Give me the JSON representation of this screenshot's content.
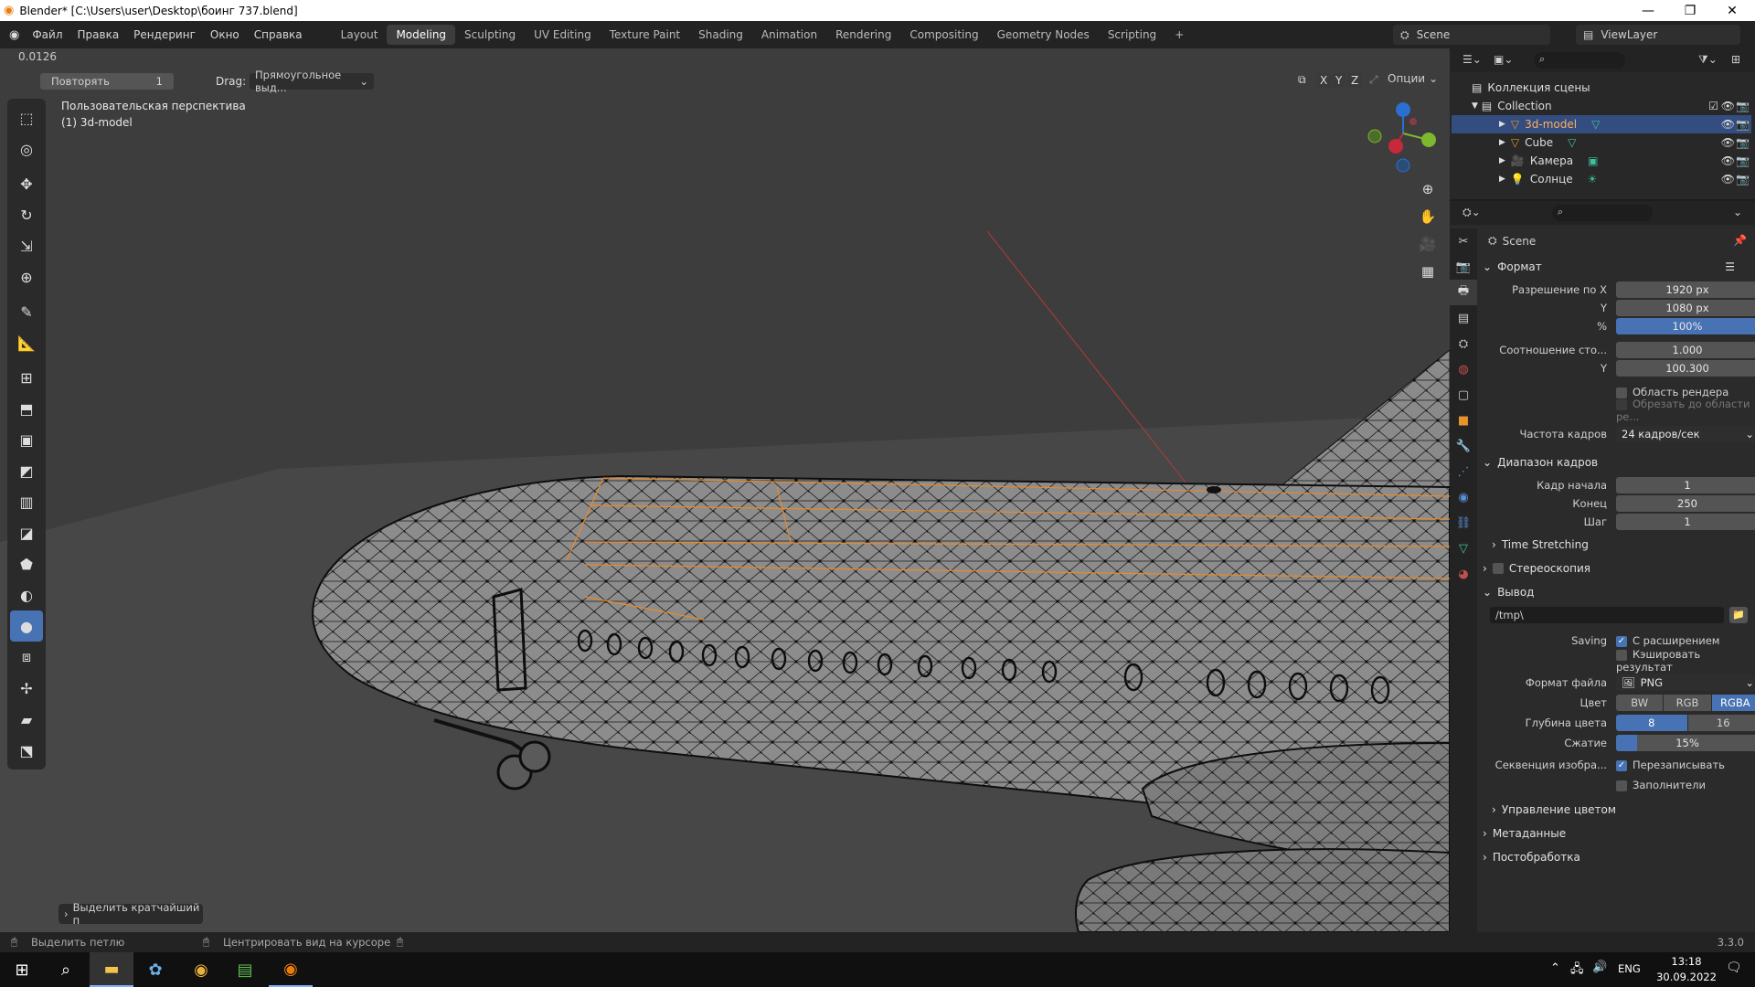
{
  "window": {
    "title": "Blender* [C:\\Users\\user\\Desktop\\боинг 737.blend]",
    "minimize": "—",
    "maximize": "❐",
    "close": "✕"
  },
  "menu": [
    "Файл",
    "Правка",
    "Рендеринг",
    "Окно",
    "Справка"
  ],
  "workspaces": [
    "Layout",
    "Modeling",
    "Sculpting",
    "UV Editing",
    "Texture Paint",
    "Shading",
    "Animation",
    "Rendering",
    "Compositing",
    "Geometry Nodes",
    "Scripting",
    "+"
  ],
  "active_workspace": "Modeling",
  "scene_name": "Scene",
  "view_layer": "ViewLayer",
  "viewport": {
    "value_readout": "0.0126",
    "repeat_label": "Повторять",
    "repeat_value": "1",
    "drag_label": "Drag:",
    "drag_value": "Прямоугольное выд...",
    "axis_x": "X",
    "axis_y": "Y",
    "axis_z": "Z",
    "options": "Опции",
    "view_name": "Пользовательская перспектива",
    "object_info": "(1) 3d-model",
    "operator_panel": "Выделить кратчайший п"
  },
  "outliner": {
    "collection_root": "Коллекция сцены",
    "collection": "Collection",
    "items": [
      {
        "name": "3d-model",
        "selected": true
      },
      {
        "name": "Cube",
        "selected": false
      },
      {
        "name": "Камера",
        "selected": false
      },
      {
        "name": "Солнце",
        "selected": false
      }
    ]
  },
  "properties": {
    "scene": "Scene",
    "format_section": "Формат",
    "res_x_label": "Разрешение по X",
    "res_x": "1920 px",
    "res_y_label": "Y",
    "res_y": "1080 px",
    "res_pct_label": "%",
    "res_pct": "100%",
    "aspect_label": "Соотношение сто...",
    "aspect_x": "1.000",
    "aspect_y_label": "Y",
    "aspect_y": "100.300",
    "render_region": "Область рендера",
    "crop_region": "Обрезать до области ре...",
    "fps_label": "Частота кадров",
    "fps": "24 кадров/сек",
    "frame_range_section": "Диапазон кадров",
    "frame_start_label": "Кадр начала",
    "frame_start": "1",
    "frame_end_label": "Конец",
    "frame_end": "250",
    "frame_step_label": "Шаг",
    "frame_step": "1",
    "time_stretching": "Time Stretching",
    "stereoscopy": "Стереоскопия",
    "output_section": "Вывод",
    "output_path": "/tmp\\",
    "saving_label": "Saving",
    "file_ext": "С расширением",
    "cache_result": "Кэшировать результат",
    "file_format_label": "Формат файла",
    "file_format": "PNG",
    "color_label": "Цвет",
    "color_bw": "BW",
    "color_rgb": "RGB",
    "color_rgba": "RGBA",
    "depth_label": "Глубина цвета",
    "depth_8": "8",
    "depth_16": "16",
    "compression_label": "Сжатие",
    "compression": "15%",
    "compression_fraction": 0.15,
    "sequence_label": "Секвенция изобра...",
    "overwrite": "Перезаписывать",
    "placeholders": "Заполнители",
    "color_management": "Управление цветом",
    "metadata": "Метаданные",
    "postprocessing": "Постобработка"
  },
  "status": {
    "left_hint": "Выделить петлю",
    "mid_hint": "Центрировать вид на курсоре",
    "version": "3.3.0"
  },
  "taskbar": {
    "lang": "ENG",
    "time": "13:18",
    "date": "30.09.2022"
  }
}
